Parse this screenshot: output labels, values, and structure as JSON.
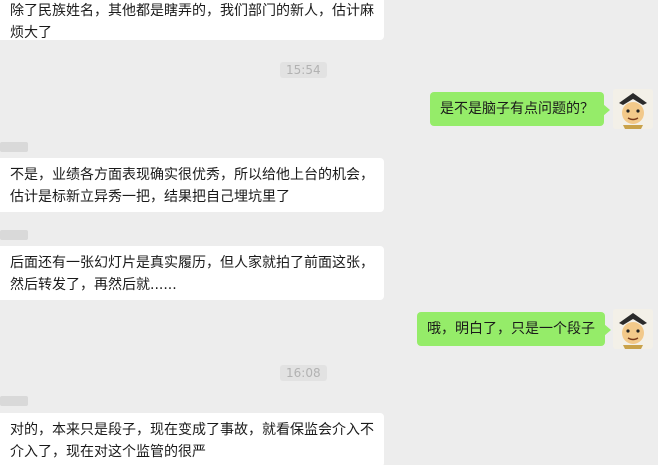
{
  "messages": [
    {
      "lines": [
        "除了民族姓名，其他都是瞎弄的，我们部门的新人，估计麻",
        "烦大了"
      ]
    },
    {
      "lines": [
        "是不是脑子有点问题的？"
      ]
    },
    {
      "lines": [
        "不是，业绩各方面表现确实很优秀，所以给他上台的机会，",
        "估计是标新立异秀一把，结果把自己埋坑里了"
      ]
    },
    {
      "lines": [
        "后面还有一张幻灯片是真实履历，但人家就拍了前面这张，",
        "然后转发了，再然后就......"
      ]
    },
    {
      "lines": [
        "哦，明白了，只是一个段子"
      ]
    },
    {
      "lines": [
        "对的，本来只是段子，现在变成了事故，就看保监会介入不",
        "介入了，现在对这个监管的很严"
      ]
    }
  ],
  "timestamps": [
    "15:54",
    "16:08"
  ],
  "colors": {
    "background": "#ededed",
    "incoming_bubble": "#ffffff",
    "outgoing_bubble": "#95ec69"
  }
}
